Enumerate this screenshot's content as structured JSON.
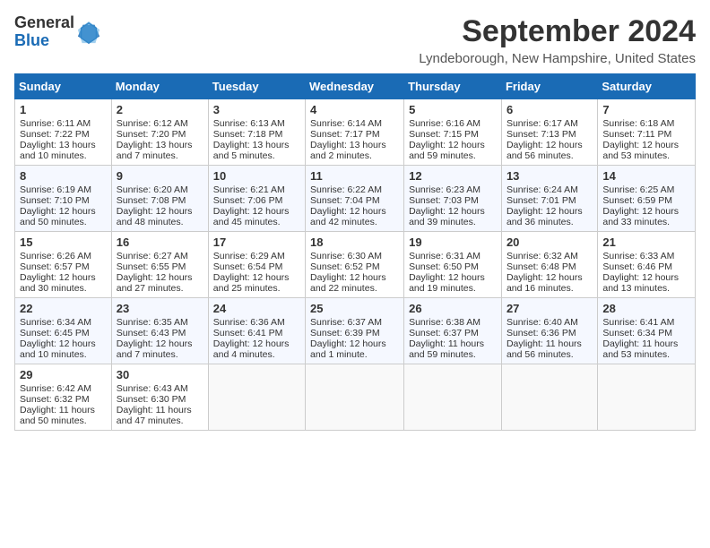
{
  "logo": {
    "general": "General",
    "blue": "Blue"
  },
  "title": "September 2024",
  "location": "Lyndeborough, New Hampshire, United States",
  "headers": [
    "Sunday",
    "Monday",
    "Tuesday",
    "Wednesday",
    "Thursday",
    "Friday",
    "Saturday"
  ],
  "weeks": [
    [
      {
        "day": "1",
        "sunrise": "Sunrise: 6:11 AM",
        "sunset": "Sunset: 7:22 PM",
        "daylight": "Daylight: 13 hours and 10 minutes."
      },
      {
        "day": "2",
        "sunrise": "Sunrise: 6:12 AM",
        "sunset": "Sunset: 7:20 PM",
        "daylight": "Daylight: 13 hours and 7 minutes."
      },
      {
        "day": "3",
        "sunrise": "Sunrise: 6:13 AM",
        "sunset": "Sunset: 7:18 PM",
        "daylight": "Daylight: 13 hours and 5 minutes."
      },
      {
        "day": "4",
        "sunrise": "Sunrise: 6:14 AM",
        "sunset": "Sunset: 7:17 PM",
        "daylight": "Daylight: 13 hours and 2 minutes."
      },
      {
        "day": "5",
        "sunrise": "Sunrise: 6:16 AM",
        "sunset": "Sunset: 7:15 PM",
        "daylight": "Daylight: 12 hours and 59 minutes."
      },
      {
        "day": "6",
        "sunrise": "Sunrise: 6:17 AM",
        "sunset": "Sunset: 7:13 PM",
        "daylight": "Daylight: 12 hours and 56 minutes."
      },
      {
        "day": "7",
        "sunrise": "Sunrise: 6:18 AM",
        "sunset": "Sunset: 7:11 PM",
        "daylight": "Daylight: 12 hours and 53 minutes."
      }
    ],
    [
      {
        "day": "8",
        "sunrise": "Sunrise: 6:19 AM",
        "sunset": "Sunset: 7:10 PM",
        "daylight": "Daylight: 12 hours and 50 minutes."
      },
      {
        "day": "9",
        "sunrise": "Sunrise: 6:20 AM",
        "sunset": "Sunset: 7:08 PM",
        "daylight": "Daylight: 12 hours and 48 minutes."
      },
      {
        "day": "10",
        "sunrise": "Sunrise: 6:21 AM",
        "sunset": "Sunset: 7:06 PM",
        "daylight": "Daylight: 12 hours and 45 minutes."
      },
      {
        "day": "11",
        "sunrise": "Sunrise: 6:22 AM",
        "sunset": "Sunset: 7:04 PM",
        "daylight": "Daylight: 12 hours and 42 minutes."
      },
      {
        "day": "12",
        "sunrise": "Sunrise: 6:23 AM",
        "sunset": "Sunset: 7:03 PM",
        "daylight": "Daylight: 12 hours and 39 minutes."
      },
      {
        "day": "13",
        "sunrise": "Sunrise: 6:24 AM",
        "sunset": "Sunset: 7:01 PM",
        "daylight": "Daylight: 12 hours and 36 minutes."
      },
      {
        "day": "14",
        "sunrise": "Sunrise: 6:25 AM",
        "sunset": "Sunset: 6:59 PM",
        "daylight": "Daylight: 12 hours and 33 minutes."
      }
    ],
    [
      {
        "day": "15",
        "sunrise": "Sunrise: 6:26 AM",
        "sunset": "Sunset: 6:57 PM",
        "daylight": "Daylight: 12 hours and 30 minutes."
      },
      {
        "day": "16",
        "sunrise": "Sunrise: 6:27 AM",
        "sunset": "Sunset: 6:55 PM",
        "daylight": "Daylight: 12 hours and 27 minutes."
      },
      {
        "day": "17",
        "sunrise": "Sunrise: 6:29 AM",
        "sunset": "Sunset: 6:54 PM",
        "daylight": "Daylight: 12 hours and 25 minutes."
      },
      {
        "day": "18",
        "sunrise": "Sunrise: 6:30 AM",
        "sunset": "Sunset: 6:52 PM",
        "daylight": "Daylight: 12 hours and 22 minutes."
      },
      {
        "day": "19",
        "sunrise": "Sunrise: 6:31 AM",
        "sunset": "Sunset: 6:50 PM",
        "daylight": "Daylight: 12 hours and 19 minutes."
      },
      {
        "day": "20",
        "sunrise": "Sunrise: 6:32 AM",
        "sunset": "Sunset: 6:48 PM",
        "daylight": "Daylight: 12 hours and 16 minutes."
      },
      {
        "day": "21",
        "sunrise": "Sunrise: 6:33 AM",
        "sunset": "Sunset: 6:46 PM",
        "daylight": "Daylight: 12 hours and 13 minutes."
      }
    ],
    [
      {
        "day": "22",
        "sunrise": "Sunrise: 6:34 AM",
        "sunset": "Sunset: 6:45 PM",
        "daylight": "Daylight: 12 hours and 10 minutes."
      },
      {
        "day": "23",
        "sunrise": "Sunrise: 6:35 AM",
        "sunset": "Sunset: 6:43 PM",
        "daylight": "Daylight: 12 hours and 7 minutes."
      },
      {
        "day": "24",
        "sunrise": "Sunrise: 6:36 AM",
        "sunset": "Sunset: 6:41 PM",
        "daylight": "Daylight: 12 hours and 4 minutes."
      },
      {
        "day": "25",
        "sunrise": "Sunrise: 6:37 AM",
        "sunset": "Sunset: 6:39 PM",
        "daylight": "Daylight: 12 hours and 1 minute."
      },
      {
        "day": "26",
        "sunrise": "Sunrise: 6:38 AM",
        "sunset": "Sunset: 6:37 PM",
        "daylight": "Daylight: 11 hours and 59 minutes."
      },
      {
        "day": "27",
        "sunrise": "Sunrise: 6:40 AM",
        "sunset": "Sunset: 6:36 PM",
        "daylight": "Daylight: 11 hours and 56 minutes."
      },
      {
        "day": "28",
        "sunrise": "Sunrise: 6:41 AM",
        "sunset": "Sunset: 6:34 PM",
        "daylight": "Daylight: 11 hours and 53 minutes."
      }
    ],
    [
      {
        "day": "29",
        "sunrise": "Sunrise: 6:42 AM",
        "sunset": "Sunset: 6:32 PM",
        "daylight": "Daylight: 11 hours and 50 minutes."
      },
      {
        "day": "30",
        "sunrise": "Sunrise: 6:43 AM",
        "sunset": "Sunset: 6:30 PM",
        "daylight": "Daylight: 11 hours and 47 minutes."
      },
      null,
      null,
      null,
      null,
      null
    ]
  ]
}
